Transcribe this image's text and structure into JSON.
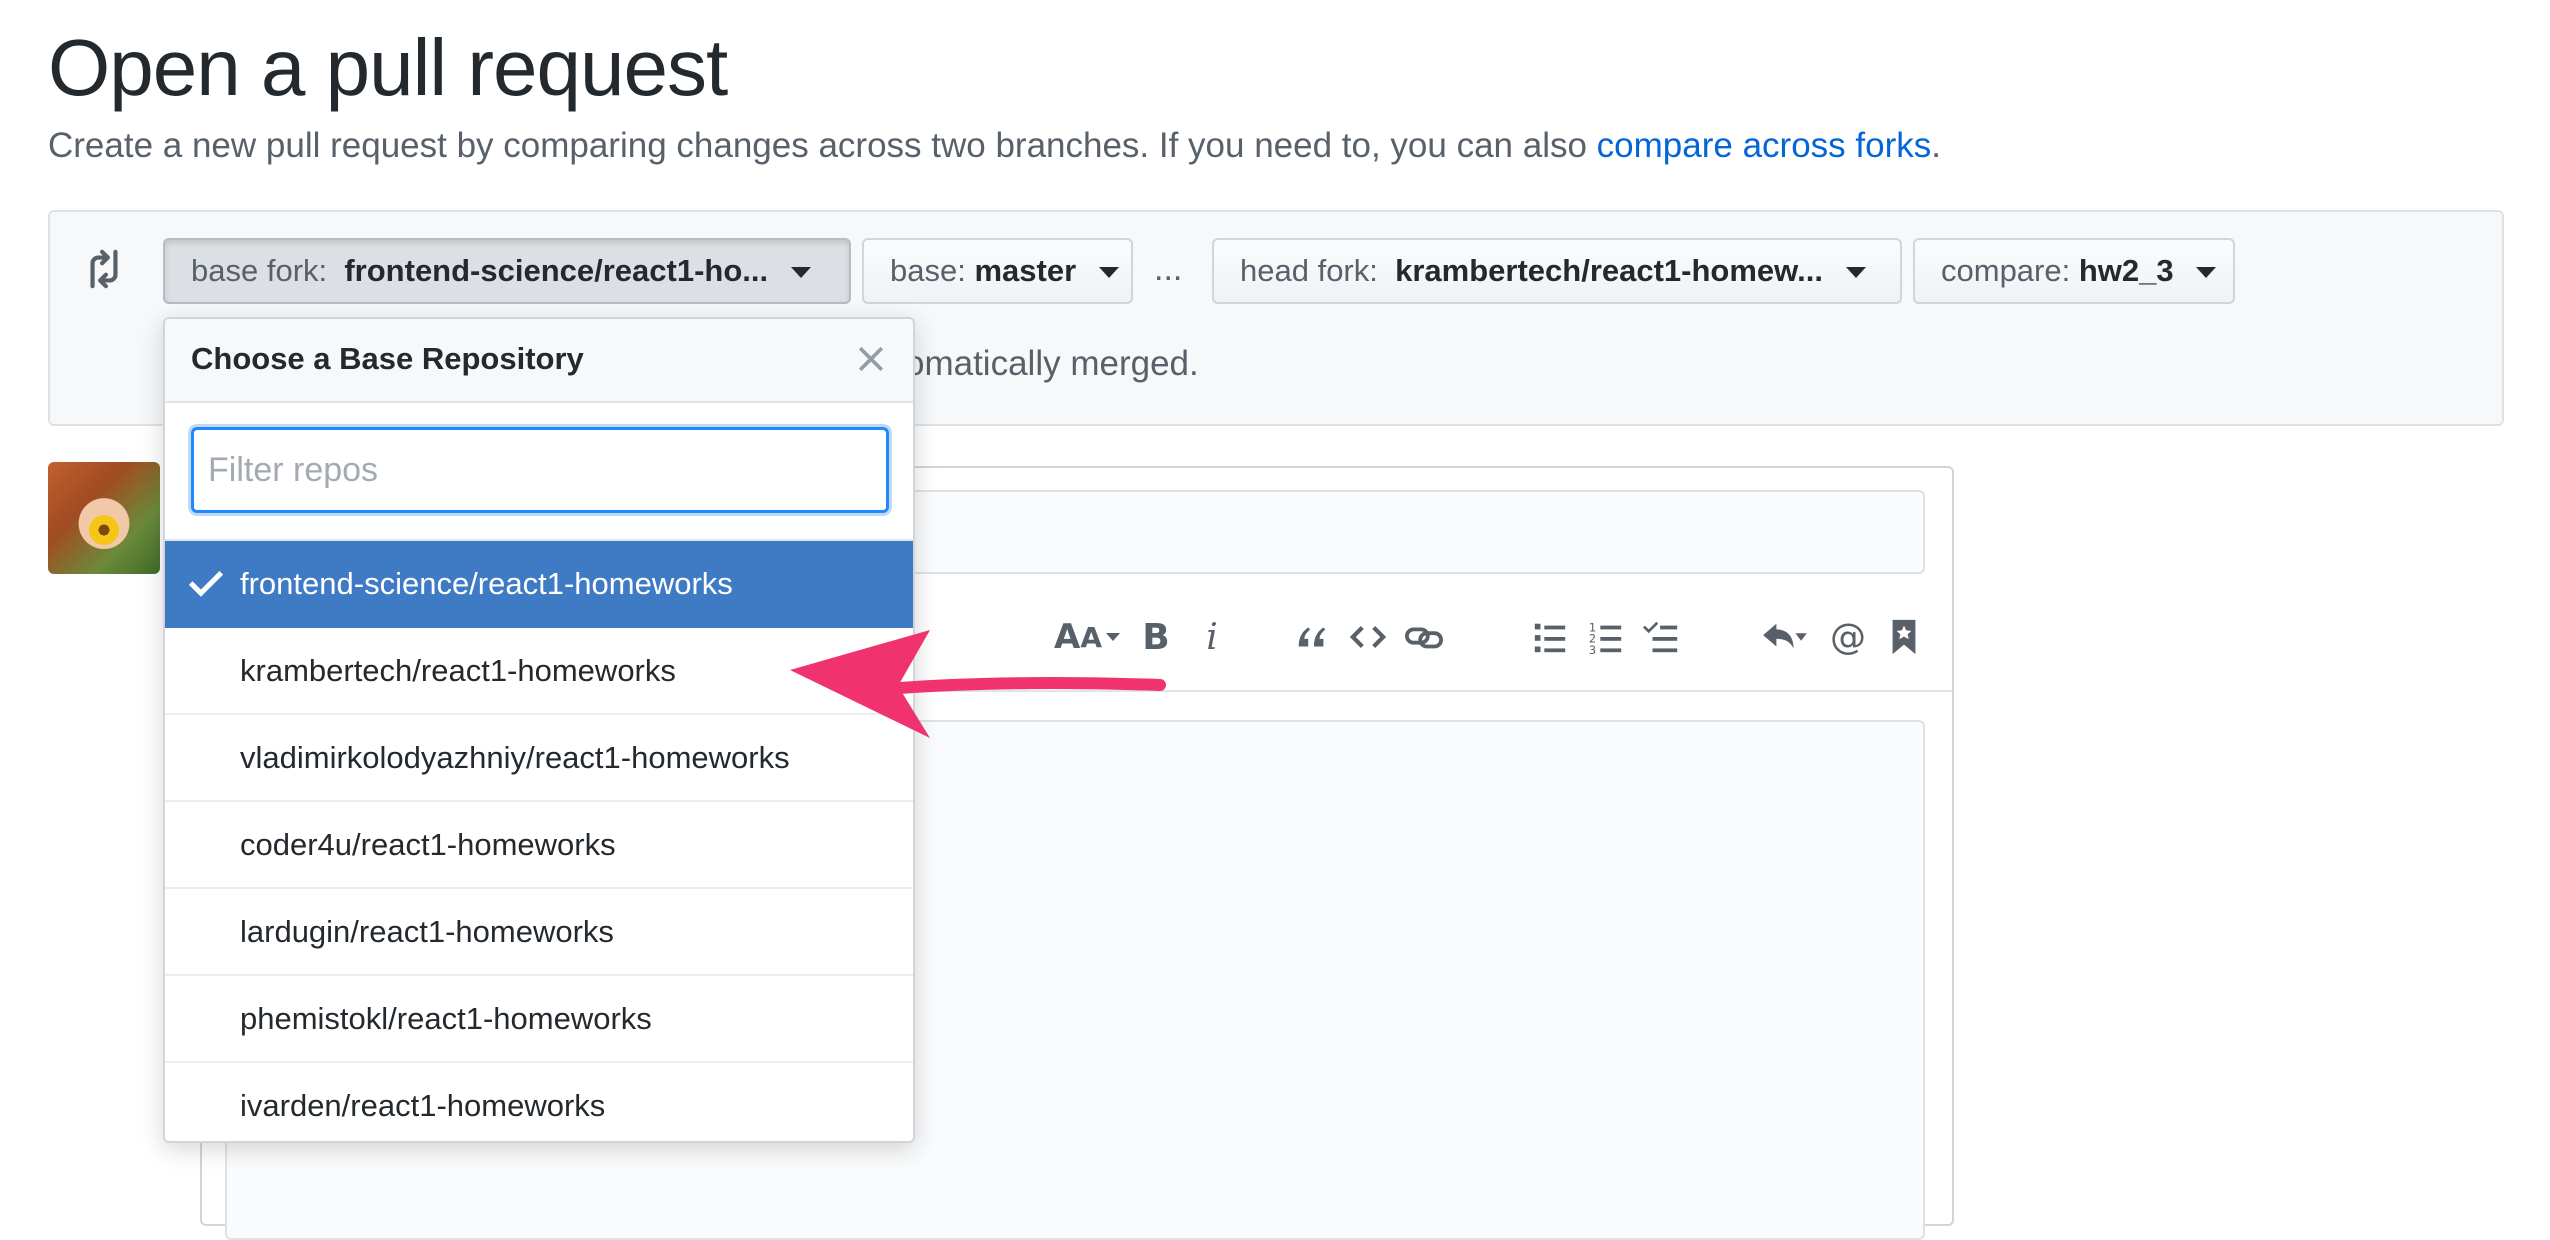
{
  "page": {
    "title": "Open a pull request",
    "subtitle": "Create a new pull request by comparing changes across two branches. If you need to, you can also ",
    "subtitle_link": "compare across forks",
    "subtitle_end": "."
  },
  "range": {
    "base_fork_label": "base fork:",
    "base_fork_value": "frontend-science/react1-ho...",
    "base_label": "base:",
    "base_value": "master",
    "ellipsis": "...",
    "head_fork_label": "head fork:",
    "head_fork_value": "krambertech/react1-homew...",
    "compare_label": "compare:",
    "compare_value": "hw2_3",
    "merge_note": "omatically merged."
  },
  "dropdown": {
    "title": "Choose a Base Repository",
    "filter_placeholder": "Filter repos",
    "items": [
      {
        "label": "frontend-science/react1-homeworks",
        "selected": true
      },
      {
        "label": "krambertech/react1-homeworks",
        "selected": false
      },
      {
        "label": "vladimirkolodyazhniy/react1-homeworks",
        "selected": false
      },
      {
        "label": "coder4u/react1-homeworks",
        "selected": false
      },
      {
        "label": "lardugin/react1-homeworks",
        "selected": false
      },
      {
        "label": "phemistokl/react1-homeworks",
        "selected": false
      },
      {
        "label": "ivarden/react1-homeworks",
        "selected": false
      }
    ]
  },
  "toolbar": {
    "bold": "B",
    "italic": "i",
    "mention": "@",
    "icons": [
      "text-size-icon",
      "bold-icon",
      "italic-icon",
      "quote-icon",
      "code-icon",
      "link-icon",
      "unordered-list-icon",
      "ordered-list-icon",
      "task-list-icon",
      "reply-icon",
      "mention-icon",
      "bookmark-icon"
    ]
  },
  "colors": {
    "accent_blue": "#0366d6",
    "selected_row": "#3f7bc5",
    "annotation_arrow": "#f0336e"
  }
}
